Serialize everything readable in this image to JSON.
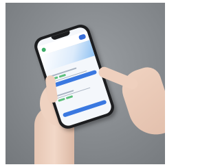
{
  "scene": {
    "description_colors": {
      "background": "#85898d",
      "phone_body": "#1c1d1f",
      "screen": "#f4f7fb",
      "accent_blue": "#3a78e0",
      "accent_green": "#5cbf7a"
    },
    "icons": [
      "app-logo-icon",
      "menu-icon"
    ]
  }
}
